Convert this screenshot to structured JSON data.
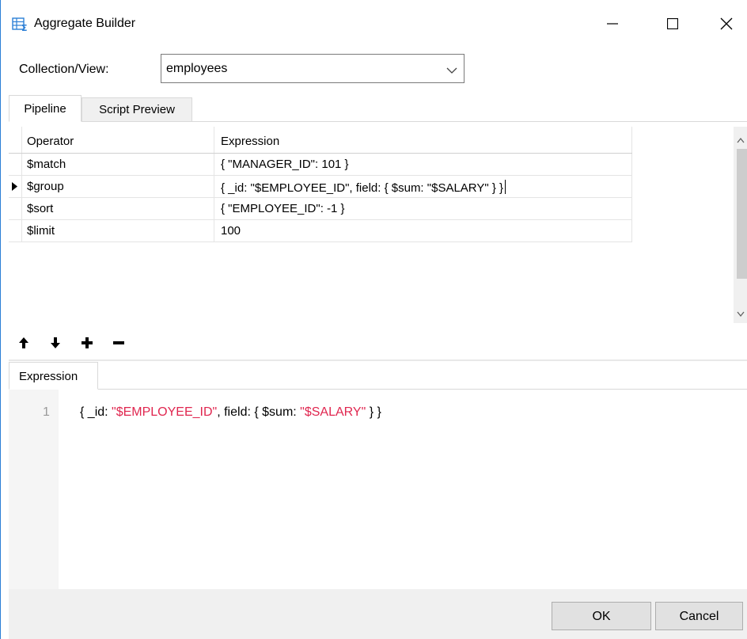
{
  "window": {
    "title": "Aggregate Builder",
    "icon": "aggregate-table-icon"
  },
  "collection": {
    "label": "Collection/View:",
    "value": "employees"
  },
  "tabs": [
    {
      "label": "Pipeline",
      "active": true
    },
    {
      "label": "Script Preview",
      "active": false
    }
  ],
  "grid": {
    "columns": [
      "Operator",
      "Expression"
    ],
    "rows": [
      {
        "operator": "$match",
        "expression": "{ \"MANAGER_ID\": 101 }",
        "current": false
      },
      {
        "operator": "$group",
        "expression": "{ _id: \"$EMPLOYEE_ID\", field: { $sum: \"$SALARY\" } }",
        "current": true
      },
      {
        "operator": "$sort",
        "expression": "{ \"EMPLOYEE_ID\": -1 }",
        "current": false
      },
      {
        "operator": "$limit",
        "expression": "100",
        "current": false
      }
    ]
  },
  "toolbar": {
    "icons": [
      "arrow-up-icon",
      "arrow-down-icon",
      "plus-icon",
      "minus-icon"
    ]
  },
  "expression_panel": {
    "tab_label": "Expression",
    "line_number": "1",
    "code_parts": {
      "p1": "{ _id: ",
      "s1": "\"$EMPLOYEE_ID\"",
      "p2": ", field: { $sum: ",
      "s2": "\"$SALARY\"",
      "p3": " } }"
    },
    "string_color": "#e0264f"
  },
  "footer": {
    "ok_label": "OK",
    "cancel_label": "Cancel"
  }
}
